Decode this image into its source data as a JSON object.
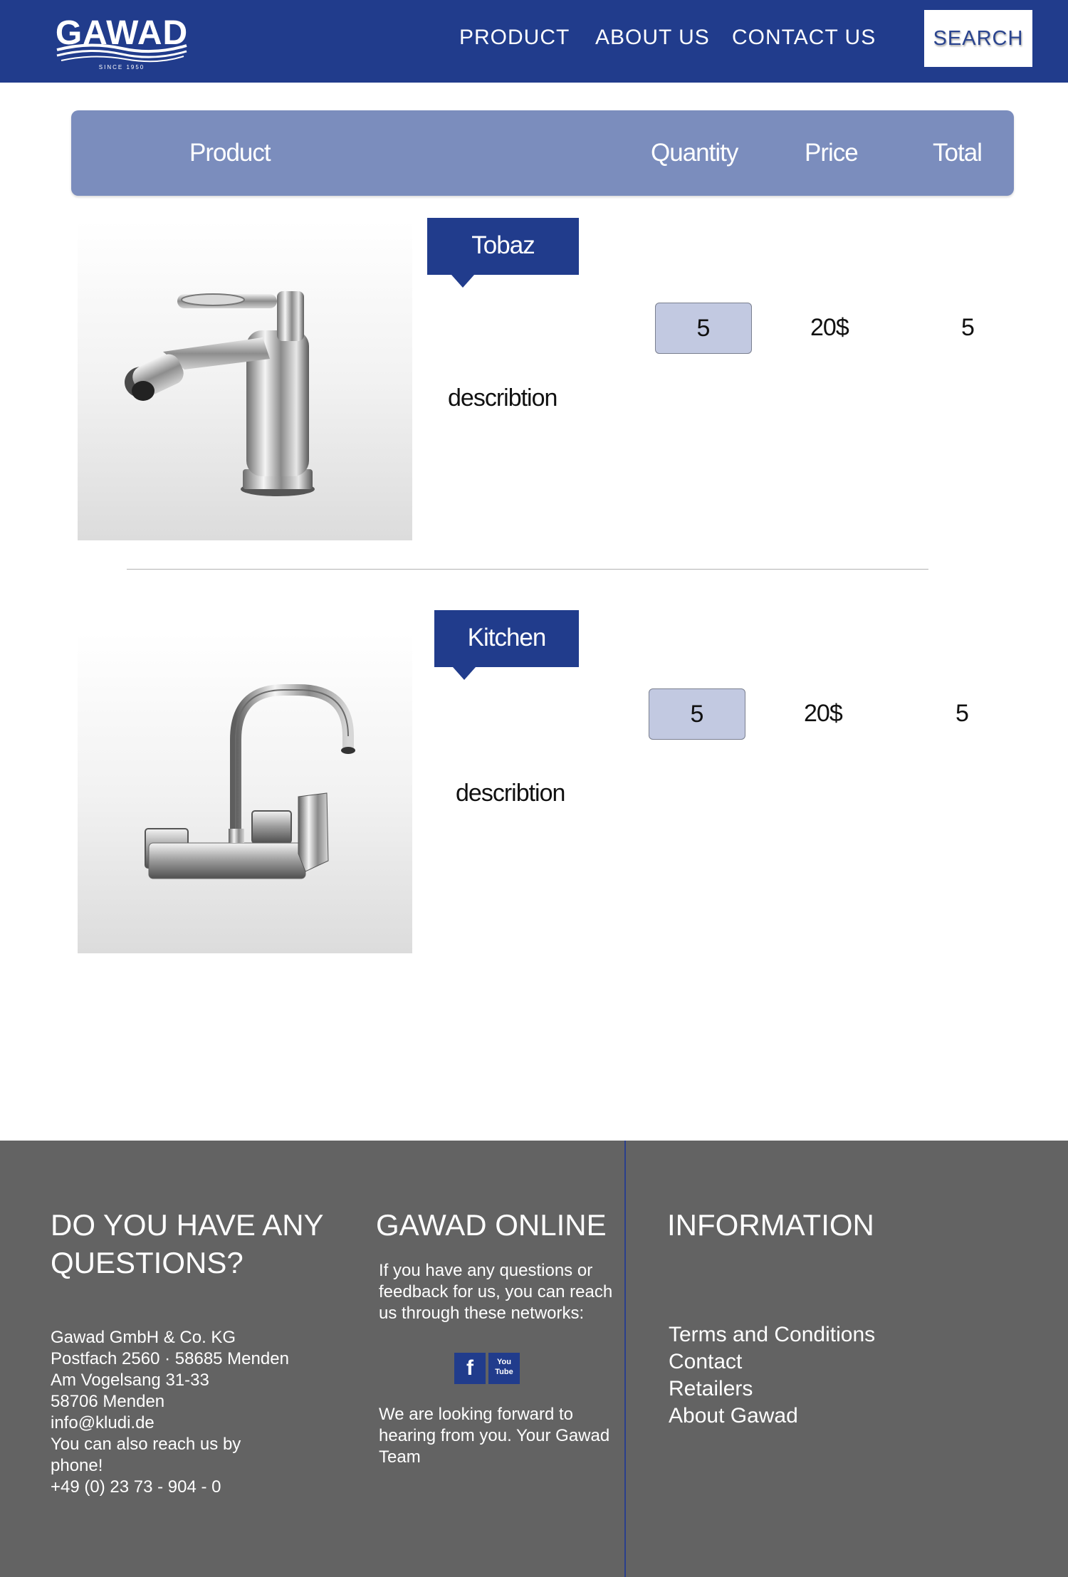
{
  "header": {
    "logo_text": "GAWAD",
    "logo_since": "SINCE 1950",
    "nav": {
      "product": "PRODUCT",
      "about": "ABOUT US",
      "contact": "CONTACT US"
    },
    "search_label": "SEARCH",
    "colors": {
      "bar": "#213c8c",
      "search_text": "#2a448f"
    }
  },
  "cart": {
    "columns": {
      "product": "Product",
      "quantity": "Quantity",
      "price": "Price",
      "total": "Total"
    },
    "header_color": "#7b8dbd",
    "items": [
      {
        "name": "Tobaz",
        "description": "describtion",
        "quantity": "5",
        "price": "20$",
        "total": "5",
        "image": "bidet-faucet-image"
      },
      {
        "name": "Kitchen",
        "description": "describtion",
        "quantity": "5",
        "price": "20$",
        "total": "5",
        "image": "wall-kitchen-faucet-image"
      }
    ]
  },
  "footer": {
    "background": "#636363",
    "questions": {
      "heading": "DO YOU HAVE ANY QUESTIONS?",
      "lines": [
        "Gawad GmbH & Co. KG",
        "Postfach 2560 · 58685 Menden",
        "Am Vogelsang 31-33",
        "58706 Menden",
        "info@kludi.de",
        "You can also reach us by phone!",
        "+49 (0) 23 73 - 904 - 0"
      ]
    },
    "online": {
      "heading": "GAWAD ONLINE",
      "intro": "If you have any questions or feedback for us, you can reach us through these networks:",
      "social": [
        {
          "icon": "facebook-icon",
          "glyph": "f"
        },
        {
          "icon": "youtube-icon",
          "glyph": "You Tube"
        }
      ],
      "outro": "We are looking forward to hearing from you. Your Gawad Team"
    },
    "information": {
      "heading": "INFORMATION",
      "links": [
        "Terms and Conditions",
        "Contact",
        "Retailers",
        "About Gawad"
      ]
    }
  }
}
